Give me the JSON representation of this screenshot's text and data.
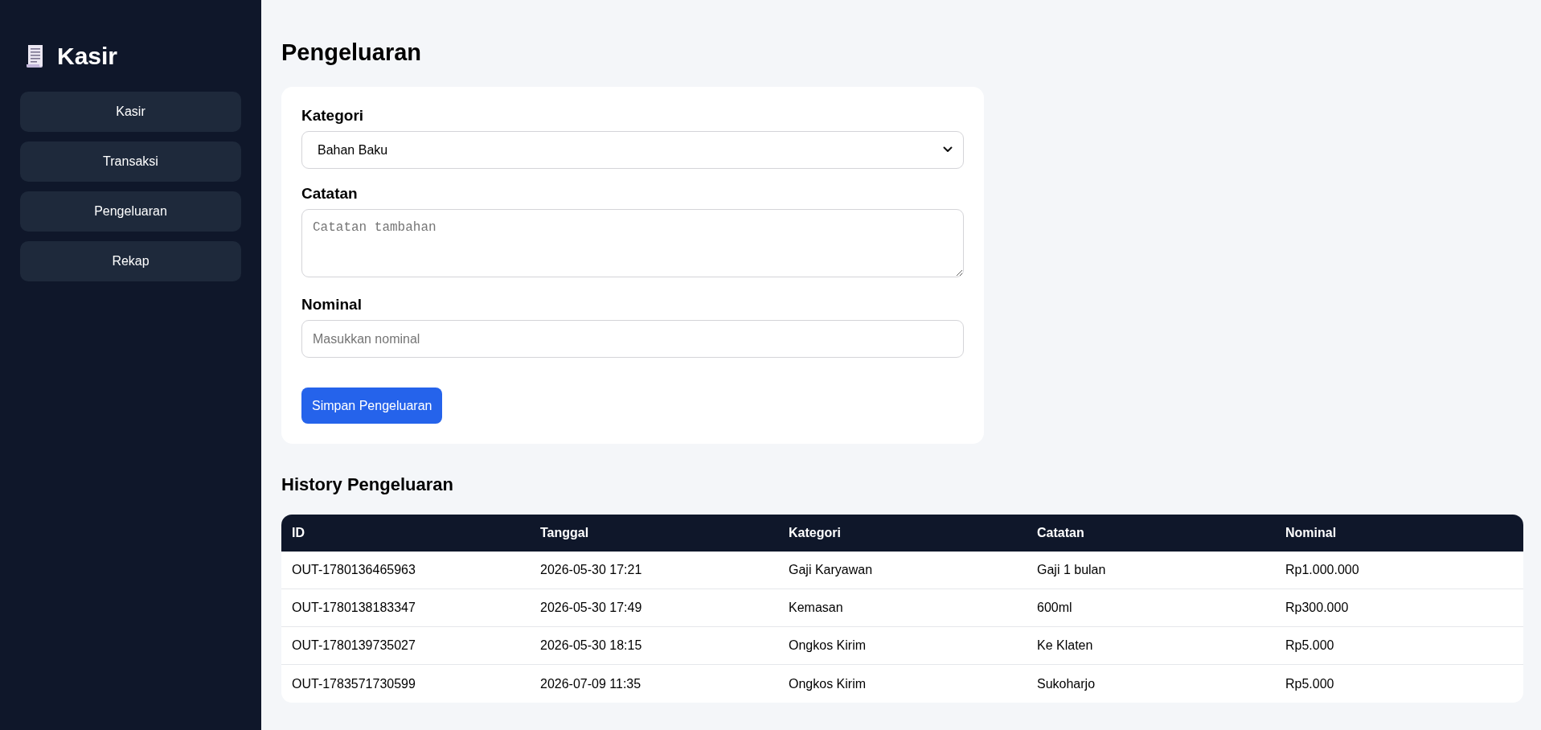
{
  "sidebar": {
    "title": "Kasir",
    "items": [
      {
        "label": "Kasir"
      },
      {
        "label": "Transaksi"
      },
      {
        "label": "Pengeluaran"
      },
      {
        "label": "Rekap"
      }
    ]
  },
  "page": {
    "title": "Pengeluaran"
  },
  "form": {
    "fields": [
      {
        "kind": "select",
        "label": "Kategori",
        "value": "Bahan Baku"
      },
      {
        "kind": "textarea",
        "label": "Catatan",
        "placeholder": "Catatan tambahan"
      },
      {
        "kind": "input",
        "label": "Nominal",
        "placeholder": "Masukkan nominal"
      }
    ],
    "submit": "Simpan Pengeluaran"
  },
  "history": {
    "title": "History Pengeluaran",
    "columns": [
      "ID",
      "Tanggal",
      "Kategori",
      "Catatan",
      "Nominal"
    ],
    "rows": [
      [
        "OUT-1780136465963",
        "2026-05-30 17:21",
        "Gaji Karyawan",
        "Gaji 1 bulan",
        "Rp1.000.000"
      ],
      [
        "OUT-1780138183347",
        "2026-05-30 17:49",
        "Kemasan",
        "600ml",
        "Rp300.000"
      ],
      [
        "OUT-1780139735027",
        "2026-05-30 18:15",
        "Ongkos Kirim",
        "Ke Klaten",
        "Rp5.000"
      ],
      [
        "OUT-1783571730599",
        "2026-07-09 11:35",
        "Ongkos Kirim",
        "Sukoharjo",
        "Rp5.000"
      ]
    ]
  }
}
